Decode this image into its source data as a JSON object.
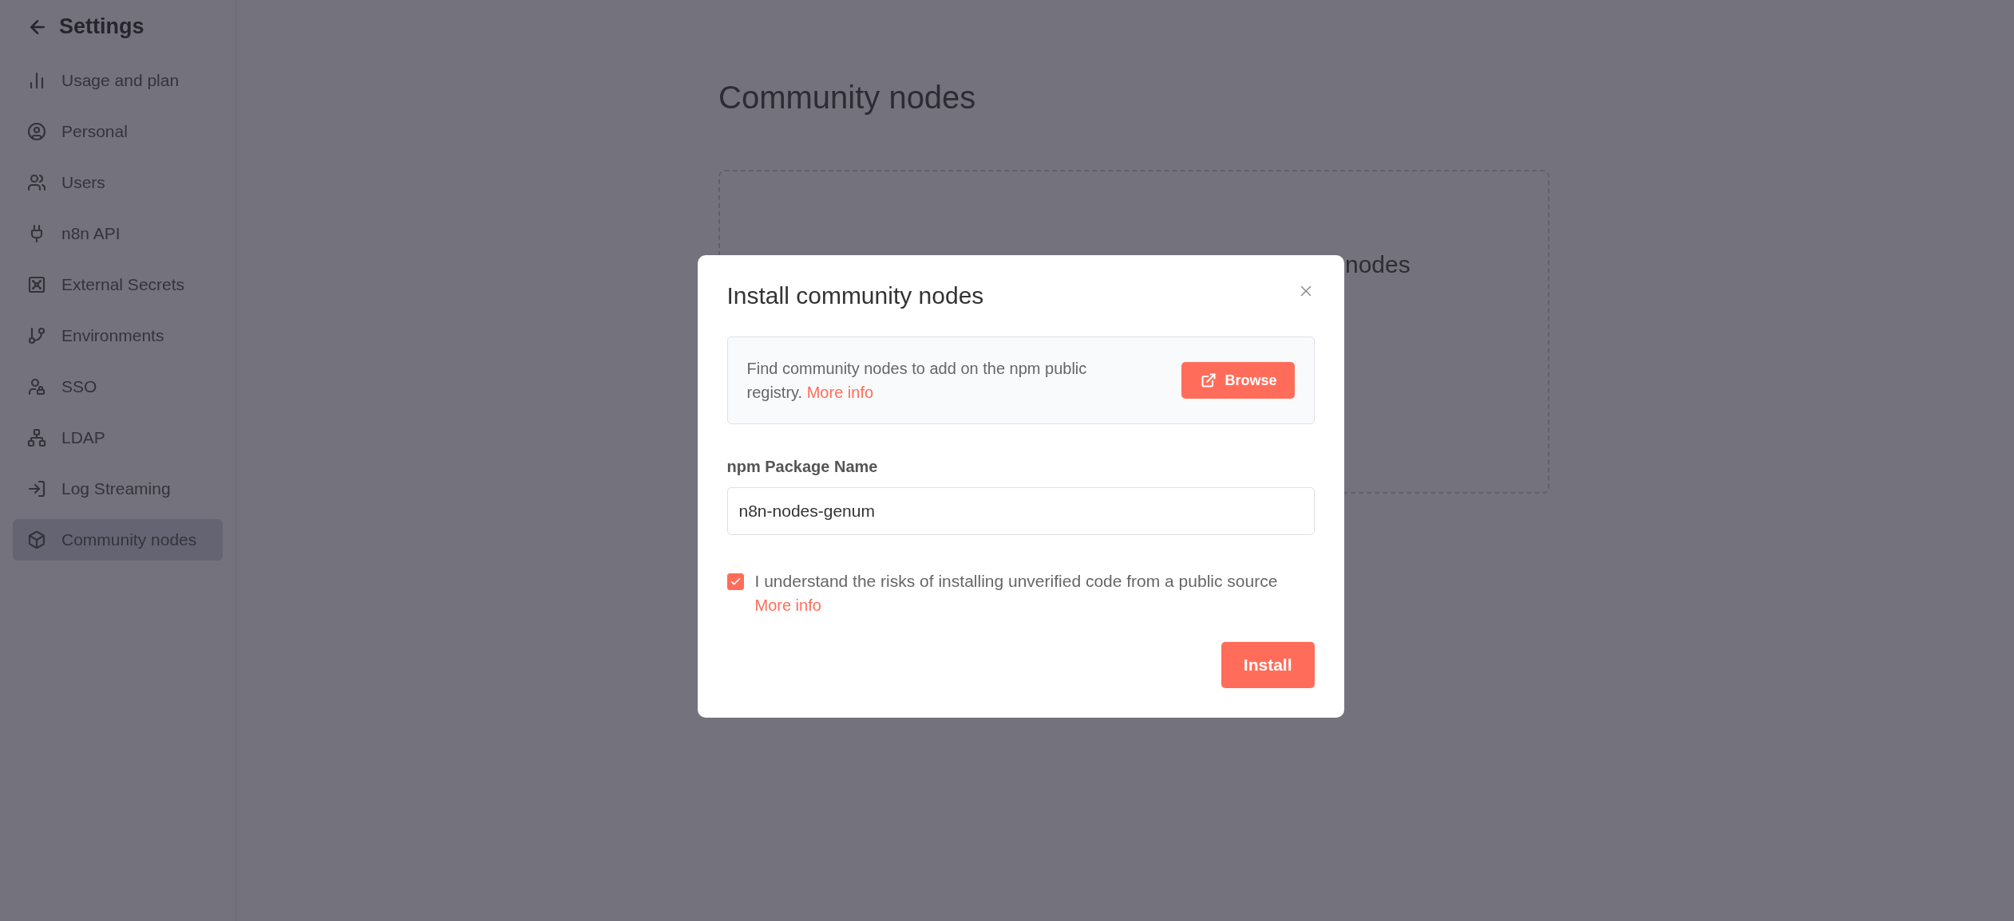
{
  "sidebar": {
    "title": "Settings",
    "items": [
      {
        "label": "Usage and plan",
        "selected": false
      },
      {
        "label": "Personal",
        "selected": false
      },
      {
        "label": "Users",
        "selected": false
      },
      {
        "label": "n8n API",
        "selected": false
      },
      {
        "label": "External Secrets",
        "selected": false
      },
      {
        "label": "Environments",
        "selected": false
      },
      {
        "label": "SSO",
        "selected": false
      },
      {
        "label": "LDAP",
        "selected": false
      },
      {
        "label": "Log Streaming",
        "selected": false
      },
      {
        "label": "Community nodes",
        "selected": true
      }
    ]
  },
  "page": {
    "title": "Community nodes",
    "card_text": "nodes"
  },
  "modal": {
    "title": "Install community nodes",
    "info": {
      "text": "Find community nodes to add on the npm public registry.",
      "link": "More info",
      "button": "Browse"
    },
    "field": {
      "label": "npm Package Name",
      "value": "n8n-nodes-genum"
    },
    "consent": {
      "checked": true,
      "text": "I understand the risks of installing unverified code from a public source",
      "link": "More info"
    },
    "button": "Install"
  }
}
